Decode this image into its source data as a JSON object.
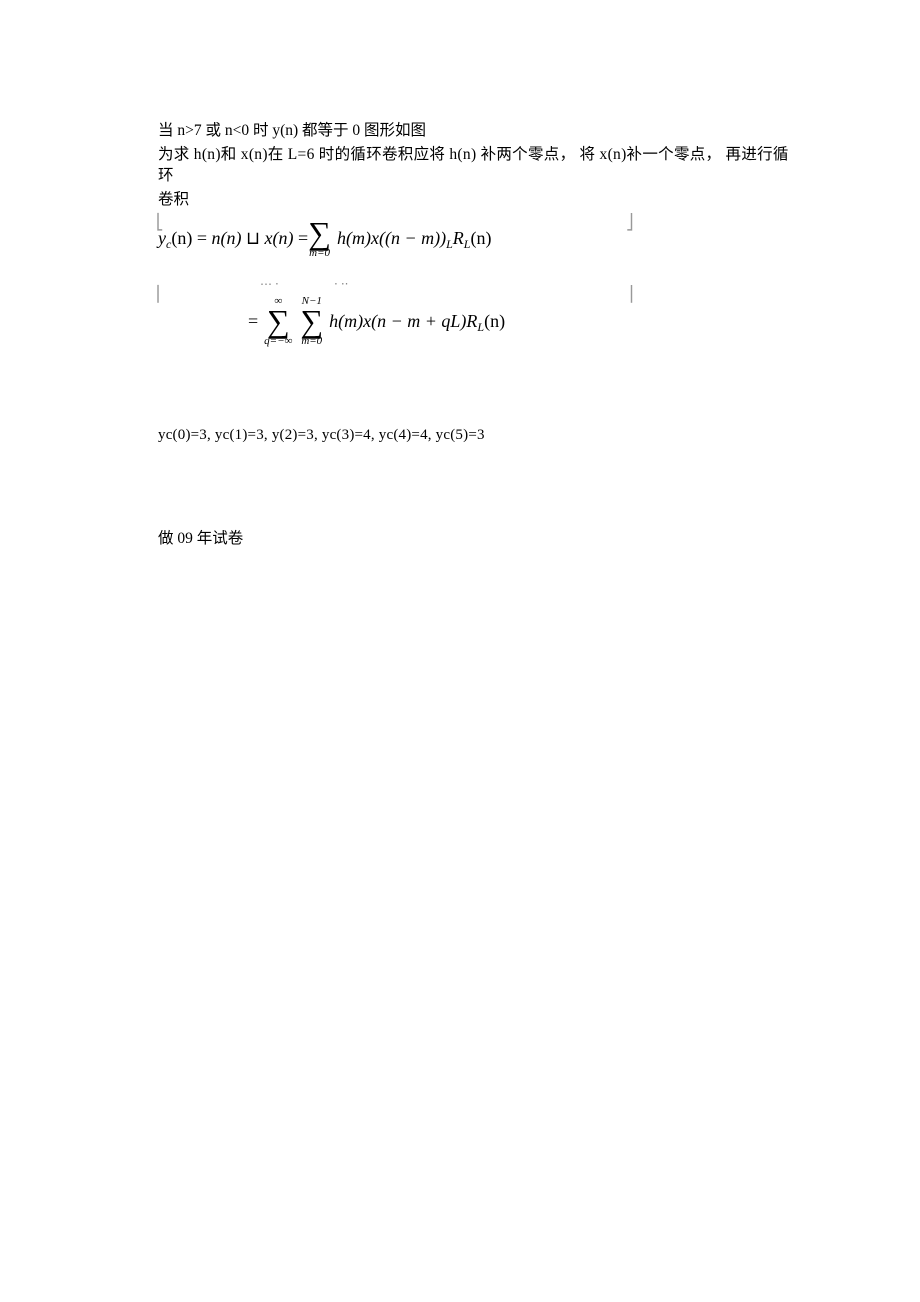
{
  "line1": "当 n>7 或 n<0 时 y(n) 都等于 0 图形如图",
  "line2": "为求 h(n)和 x(n)在 L=6 时的循环卷积应将 h(n) 补两个零点，  将 x(n)补一个零点，  再进行循环",
  "line3": "卷积",
  "formula1": {
    "lhs_y": "y",
    "lhs_sub": "c",
    "lhs_n": "(n)",
    "eq1": " = ",
    "nn": "n(n)",
    "op": " ⊔ ",
    "xn": "x(n)",
    "eq2": " = ",
    "sigma_top": "",
    "sigma_bot": "m=0",
    "hm": "h(m)x((n − m))",
    "subL": "L",
    "RL": "R",
    "RLsub": "L",
    "tail": "(n)"
  },
  "formula2": {
    "eq": "= ",
    "sig1_top": "∞",
    "sig1_bot": "q=−∞",
    "sig2_top": "N−1",
    "sig2_bot": "m=0",
    "body": "h(m)x(n − m + qL)R",
    "subL": "L",
    "tail": "(n)"
  },
  "line4": "yc(0)=3, yc(1)=3, y(2)=3, yc(3)=4, yc(4)=4, yc(5)=3",
  "line5": "做 09 年试卷"
}
